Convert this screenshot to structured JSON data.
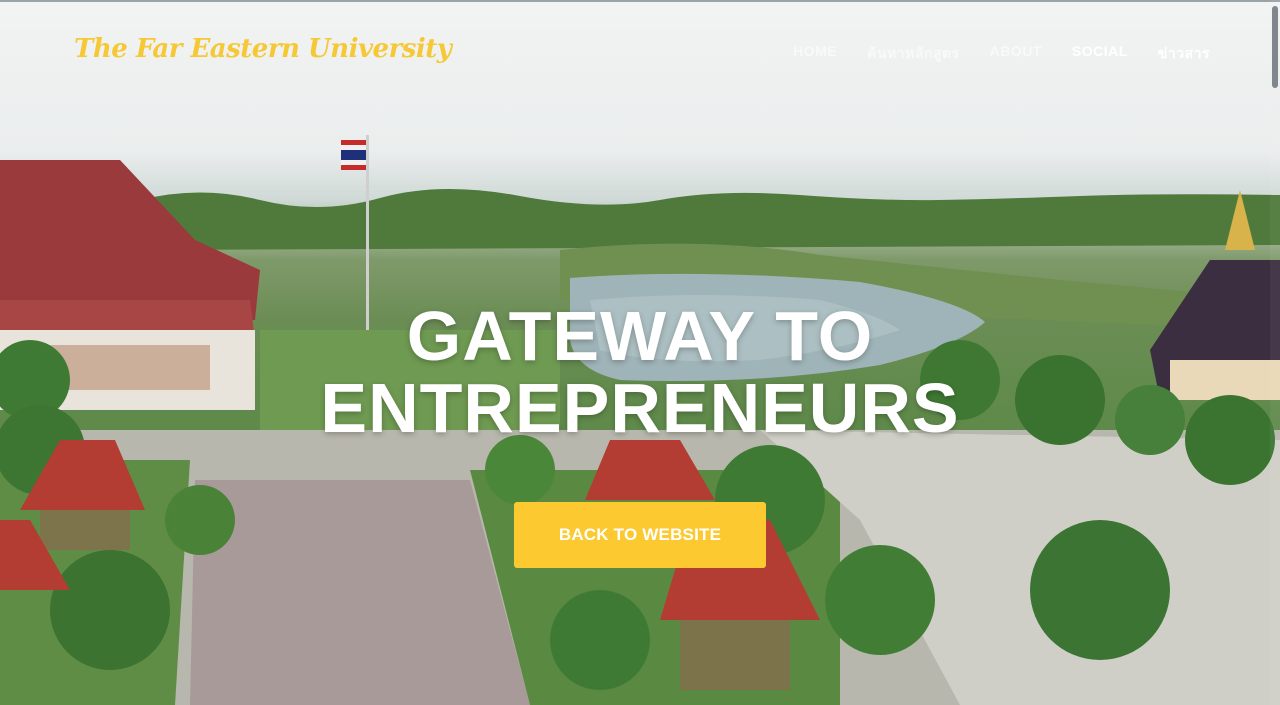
{
  "header": {
    "logo_text": "The Far Eastern University"
  },
  "nav": {
    "items": [
      {
        "label": "HOME"
      },
      {
        "label": "ค้นหาหลักสูตร"
      },
      {
        "label": "ABOUT"
      },
      {
        "label": "SOCIAL"
      },
      {
        "label": "ข่าวสาร"
      }
    ]
  },
  "hero": {
    "headline_line1": "GATEWAY TO",
    "headline_line2": "ENTREPRENEURS",
    "cta_label": "BACK TO WEBSITE"
  },
  "colors": {
    "accent": "#fcc930",
    "logo": "#f6c836",
    "text": "#ffffff"
  }
}
